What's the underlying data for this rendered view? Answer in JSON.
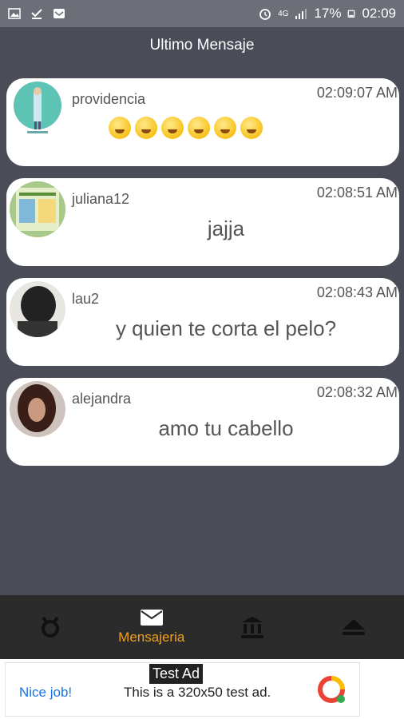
{
  "status_bar": {
    "signal_label": "4G",
    "battery": "17%",
    "time": "02:09"
  },
  "header": {
    "title": "Ultimo Mensaje"
  },
  "messages": [
    {
      "username": "providencia",
      "time": "02:09:07 AM",
      "text": "",
      "emojis": [
        "grin-squint",
        "wink-tongue",
        "grin",
        "wink-tongue",
        "wink-tongue",
        "wink-tongue"
      ]
    },
    {
      "username": "juliana12",
      "time": "02:08:51 AM",
      "text": "jajja"
    },
    {
      "username": "lau2",
      "time": "02:08:43 AM",
      "text": "y quien te corta el pelo?"
    },
    {
      "username": "alejandra",
      "time": "02:08:32 AM",
      "text": "amo tu cabello"
    }
  ],
  "nav": {
    "items": [
      {
        "icon": "profile-icon",
        "label": ""
      },
      {
        "icon": "mail-icon",
        "label": "Mensajeria"
      },
      {
        "icon": "bank-icon",
        "label": ""
      },
      {
        "icon": "eject-icon",
        "label": ""
      }
    ]
  },
  "ad": {
    "tag": "Test Ad",
    "nice": "Nice job!",
    "text": "This is a 320x50 test ad."
  },
  "colors": {
    "accent": "#f0a11a",
    "background": "#4a4d57",
    "status": "#6c6f78"
  }
}
